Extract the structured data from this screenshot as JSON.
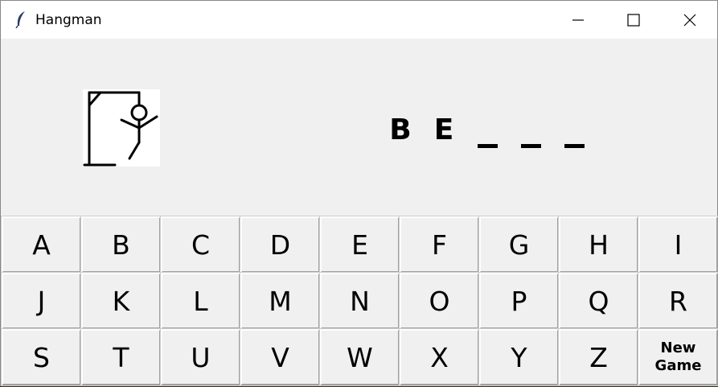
{
  "window": {
    "title": "Hangman",
    "icon": "feather-icon"
  },
  "controls": {
    "minimize": "minimize-icon",
    "maximize": "maximize-icon",
    "close": "close-icon"
  },
  "word": {
    "slots": [
      "B",
      "E",
      "",
      "",
      ""
    ]
  },
  "keyboard": {
    "keys": [
      "A",
      "B",
      "C",
      "D",
      "E",
      "F",
      "G",
      "H",
      "I",
      "J",
      "K",
      "L",
      "M",
      "N",
      "O",
      "P",
      "Q",
      "R",
      "S",
      "T",
      "U",
      "V",
      "W",
      "X",
      "Y",
      "Z"
    ],
    "new_game": "New\nGame"
  }
}
